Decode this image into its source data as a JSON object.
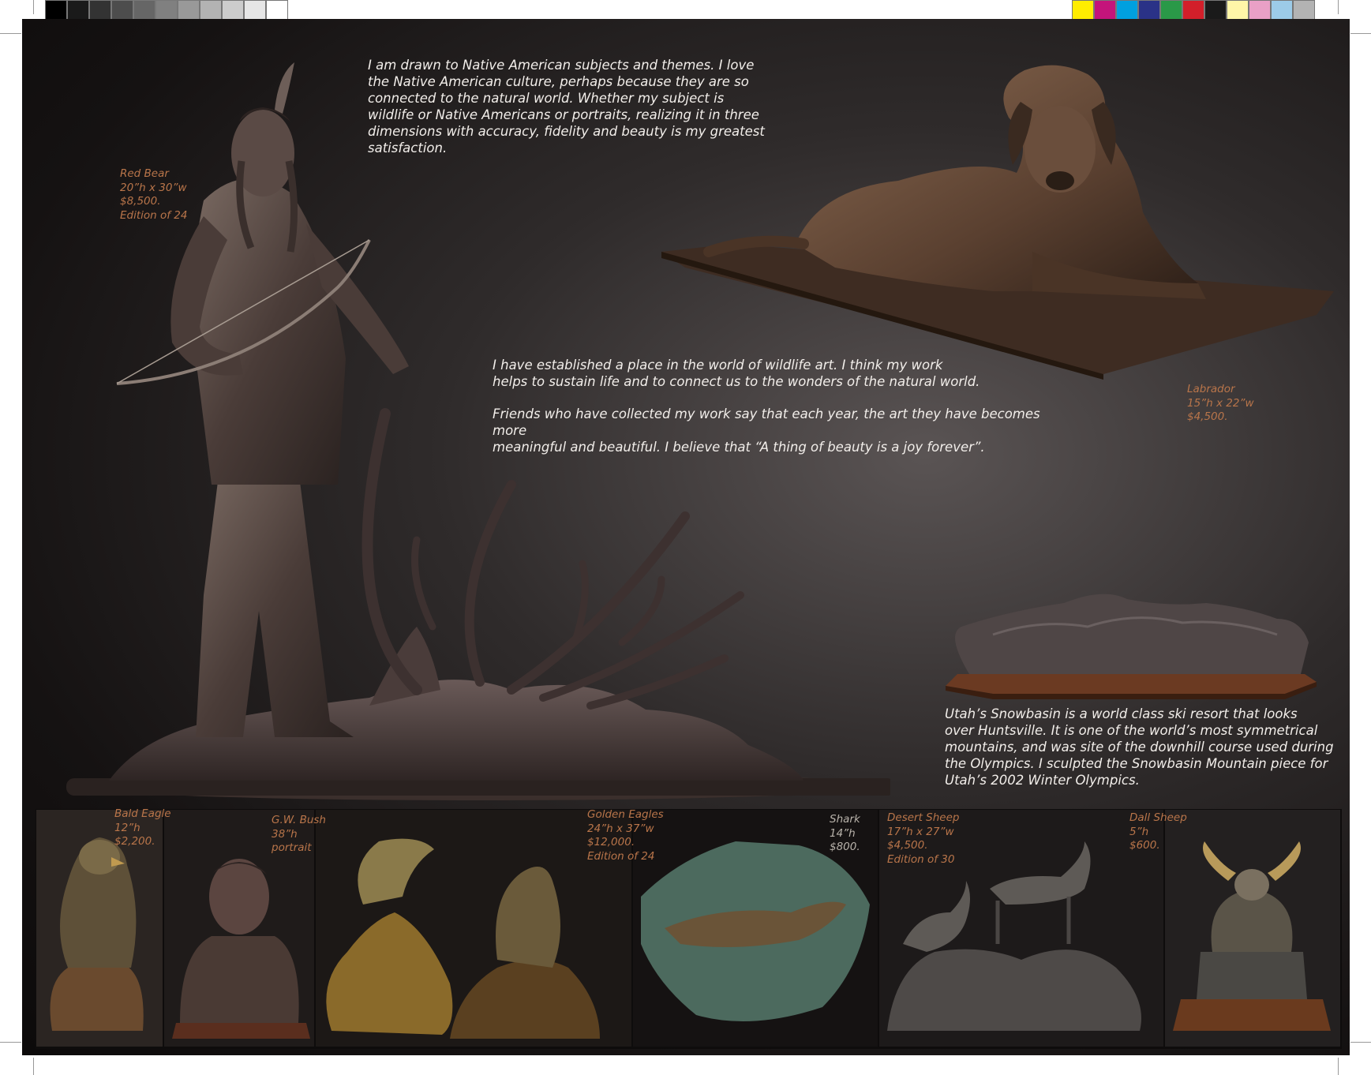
{
  "colors": {
    "background": "#151212",
    "body_text": "#f2eeea",
    "caption_text": "#b9754a",
    "bronze": "#6b5240"
  },
  "color_bar_left": [
    "#000000",
    "#1a1a1a",
    "#333333",
    "#4d4d4d",
    "#666666",
    "#808080",
    "#999999",
    "#b3b3b3",
    "#cccccc",
    "#e6e6e6",
    "#ffffff"
  ],
  "color_bar_right": [
    "#ffed00",
    "#c4147b",
    "#00a0df",
    "#2a3287",
    "#2a9948",
    "#d21f2a",
    "#1a1a1a",
    "#fff6a8",
    "#e9a0c6",
    "#9ccbe8",
    "#b3b3b3"
  ],
  "text": {
    "intro": "I am drawn to Native American subjects and themes.  I love\nthe Native American culture, perhaps because they are so\nconnected to the natural world.  Whether my subject is\nwildlife or Native Americans or portraits, realizing it in three\ndimensions with accuracy, fidelity and beauty is my greatest\nsatisfaction.",
    "wildlife_1": "I have established a place in the world of wildlife art.  I think my work\nhelps to sustain life and to connect us to the wonders of the natural world.",
    "wildlife_2": "Friends who have collected my work  say that each year, the art they have becomes more\nmeaningful and beautiful.  I believe that “A thing of beauty is a joy forever”.",
    "snowbasin": "Utah’s Snowbasin is a world class ski resort that looks\nover Huntsville. It is one of the world’s most symmetrical\nmountains, and was site of the downhill course used during\nthe Olympics. I sculpted the Snowbasin Mountain piece for\nUtah’s 2002 Winter Olympics."
  },
  "captions": {
    "red_bear": "Red Bear\n20”h x 30”w\n$8,500.\nEdition of 24",
    "labrador": "Labrador\n15”h x 22”w\n$4,500.",
    "bald_eagle": "Bald Eagle\n12”h\n$2,200.",
    "gw_bush": "G.W. Bush\n38”h\nportrait",
    "golden_eagles": "Golden Eagles\n24”h x 37”w\n$12,000.\nEdition of 24",
    "shark": "Shark\n14”h\n$800.",
    "desert_sheep": "Desert Sheep\n17”h x 27”w\n$4,500.\nEdition of 30",
    "dall_sheep": "Dall Sheep\n5”h\n$600."
  }
}
